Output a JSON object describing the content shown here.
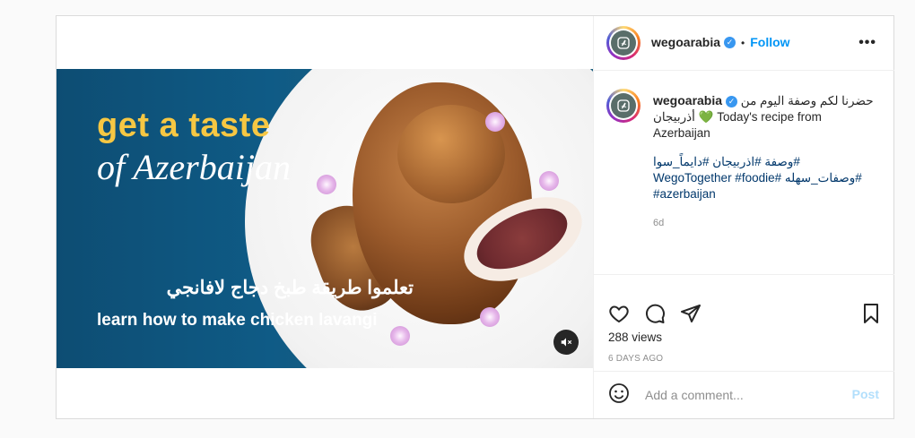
{
  "post": {
    "username": "wegoarabia",
    "verified_icon": "verified-badge-icon",
    "follow_label": "Follow",
    "dot": "•",
    "video": {
      "text_line1": "get a taste",
      "text_line2": "of Azerbaijan",
      "text_arabic": "تعلموا طريقة طبخ دجاج لافانجي",
      "text_line3": "learn how to make chicken lavangi",
      "mute_icon": "muted-speaker-icon"
    },
    "caption": {
      "username": "wegoarabia",
      "line_arabic": "حضرنا لكم وصفة اليوم من أذربيجان",
      "heart": "💚",
      "text_en": "Today's recipe from Azerbaijan",
      "hashtags_line1": "#وصفة #اذربيجان #دايماً_سوا",
      "hashtags_line2": "#وصفات_سهله #WegoTogether #foodie",
      "hashtags_line3": "#azerbaijan",
      "time": "6d"
    },
    "views": "288 views",
    "time_ago": "6 DAYS AGO",
    "comment": {
      "placeholder": "Add a comment...",
      "post_label": "Post"
    },
    "colors": {
      "accent": "#0095f6",
      "verified": "#3897f0",
      "post_disabled": "#b2dffc",
      "video_bg": "#0f5b86",
      "yellow_text": "#f6c743"
    }
  }
}
